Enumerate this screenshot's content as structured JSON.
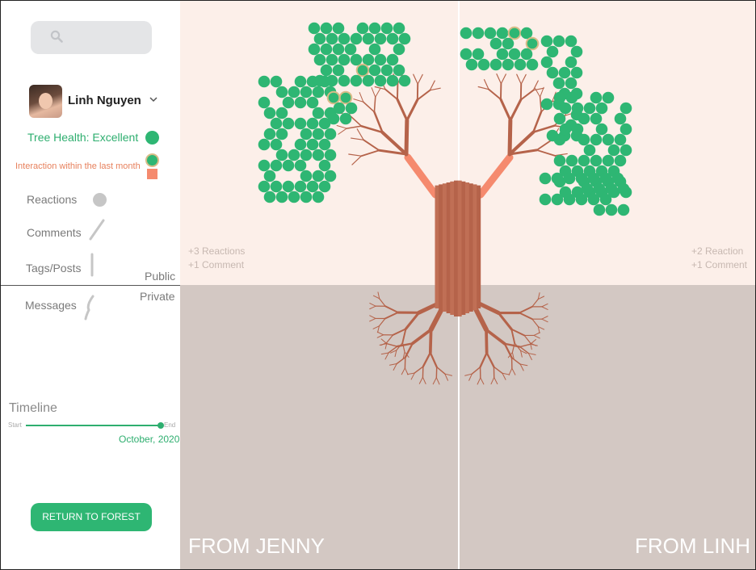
{
  "search": {
    "placeholder": ""
  },
  "user": {
    "name": "Linh Nguyen"
  },
  "legend": {
    "tree_health": "Tree Health: Excellent",
    "interaction": "Interaction within the last month",
    "reactions": "Reactions",
    "comments": "Comments",
    "tags_posts": "Tags/Posts",
    "messages": "Messages",
    "public": "Public",
    "private": "Private"
  },
  "timeline": {
    "label": "Timeline",
    "start": "Start",
    "end": "End",
    "date": "October, 2020",
    "position": 1.0
  },
  "return_button": "RETURN TO FOREST",
  "panels": {
    "left": {
      "annotation_1": "+3 Reactions",
      "annotation_2": "+1 Comment",
      "label": "FROM JENNY"
    },
    "right": {
      "annotation_1": "+2 Reaction",
      "annotation_2": "+1 Comment",
      "label": "FROM LINH"
    }
  },
  "colors": {
    "leaf_green": "#2eb673",
    "branch_brown": "#b5634a",
    "highlight_salmon": "#f58a6e",
    "interaction_ring": "#d8bc88",
    "sky": "#fcefe9",
    "ground": "#d3c8c3"
  },
  "icons": [
    "search-icon",
    "chevron-down-icon"
  ]
}
